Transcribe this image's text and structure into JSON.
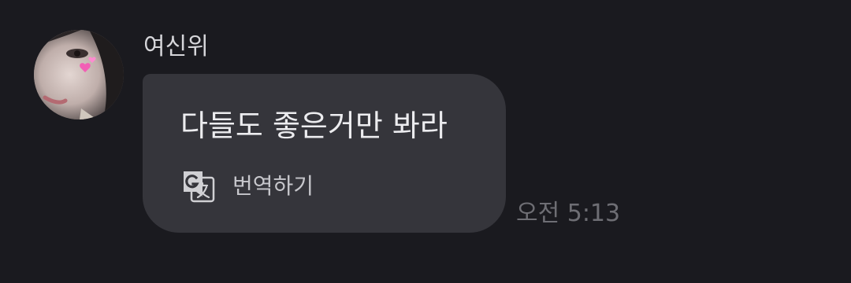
{
  "message": {
    "sender": "여신위",
    "text": "다들도 좋은거만 봐라",
    "translate_label": "번역하기",
    "time": "오전 5:13"
  },
  "icons": {
    "avatar": "profile-photo-avatar",
    "translate": "google-translate-icon"
  },
  "colors": {
    "background": "#1a1a1f",
    "bubble": "#35353b",
    "message_text": "#ececef",
    "sender_name": "#d6d6da",
    "timestamp": "#6e6e74"
  }
}
